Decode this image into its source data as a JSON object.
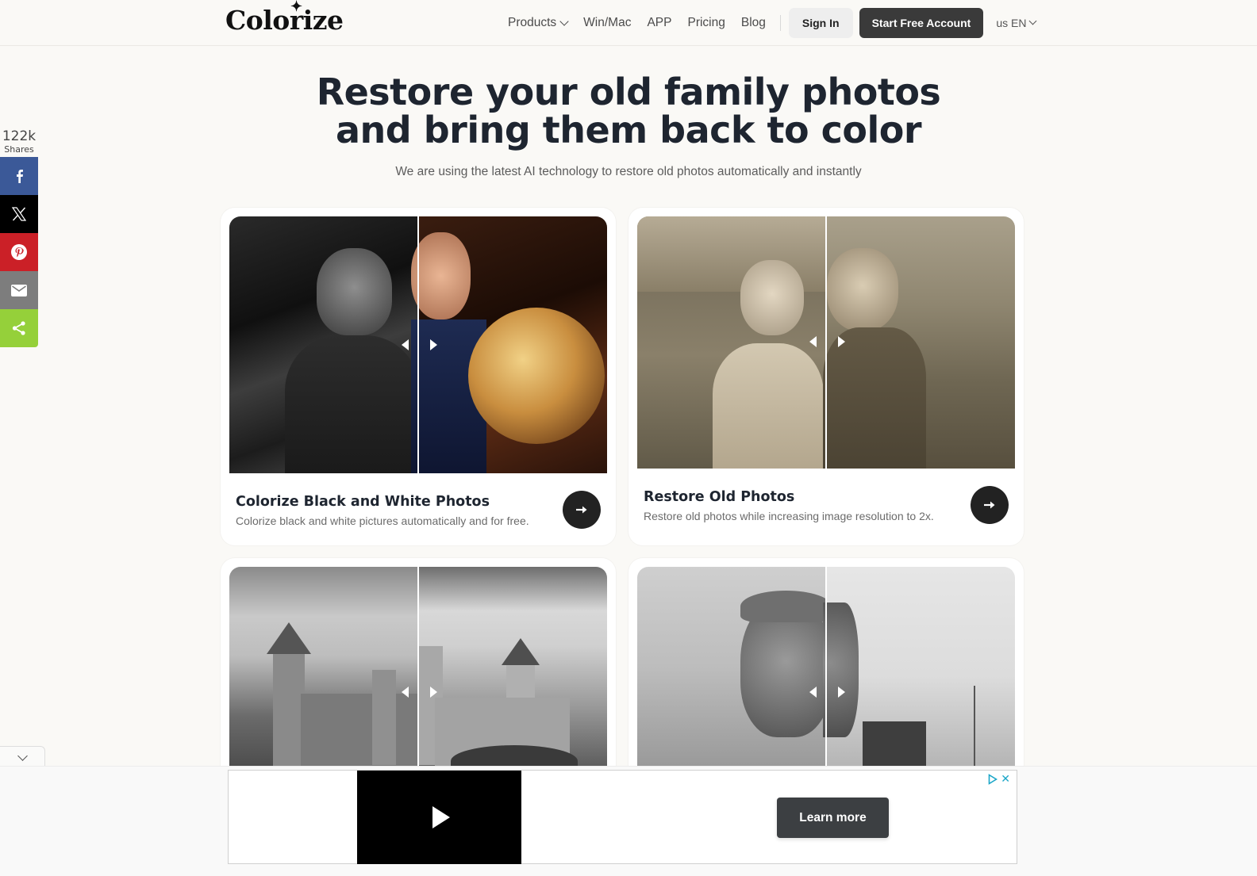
{
  "header": {
    "logo": "Colorize",
    "logo_star": "✦",
    "nav": [
      {
        "label": "Products",
        "has_dropdown": true
      },
      {
        "label": "Win/Mac"
      },
      {
        "label": "APP"
      },
      {
        "label": "Pricing"
      },
      {
        "label": "Blog"
      }
    ],
    "sign_in_label": "Sign In",
    "start_label": "Start Free Account",
    "language": "us EN"
  },
  "hero": {
    "title_line1": "Restore your old family photos",
    "title_line2": "and bring them back to color",
    "subtitle": "We are using the latest AI technology to restore old photos automatically and instantly"
  },
  "social": {
    "count": "122k",
    "count_label": "Shares",
    "buttons": [
      {
        "name": "facebook",
        "color": "#3b5998"
      },
      {
        "name": "x",
        "color": "#000000"
      },
      {
        "name": "pinterest",
        "color": "#cb2027"
      },
      {
        "name": "email",
        "color": "#7d7d7d"
      },
      {
        "name": "share",
        "color": "#95d03a"
      }
    ]
  },
  "cards": [
    {
      "title": "Colorize Black and White Photos",
      "description": "Colorize black and white pictures automatically and for free."
    },
    {
      "title": "Restore Old Photos",
      "description": "Restore old photos while increasing image resolution to 2x."
    },
    {
      "title": "",
      "description": ""
    },
    {
      "title": "",
      "description": ""
    }
  ],
  "ad": {
    "learn_more": "Learn more",
    "close": "✕"
  },
  "colors": {
    "background": "#faf9f6",
    "primary_dark": "#3a3a3a",
    "heading": "#1e2530"
  }
}
